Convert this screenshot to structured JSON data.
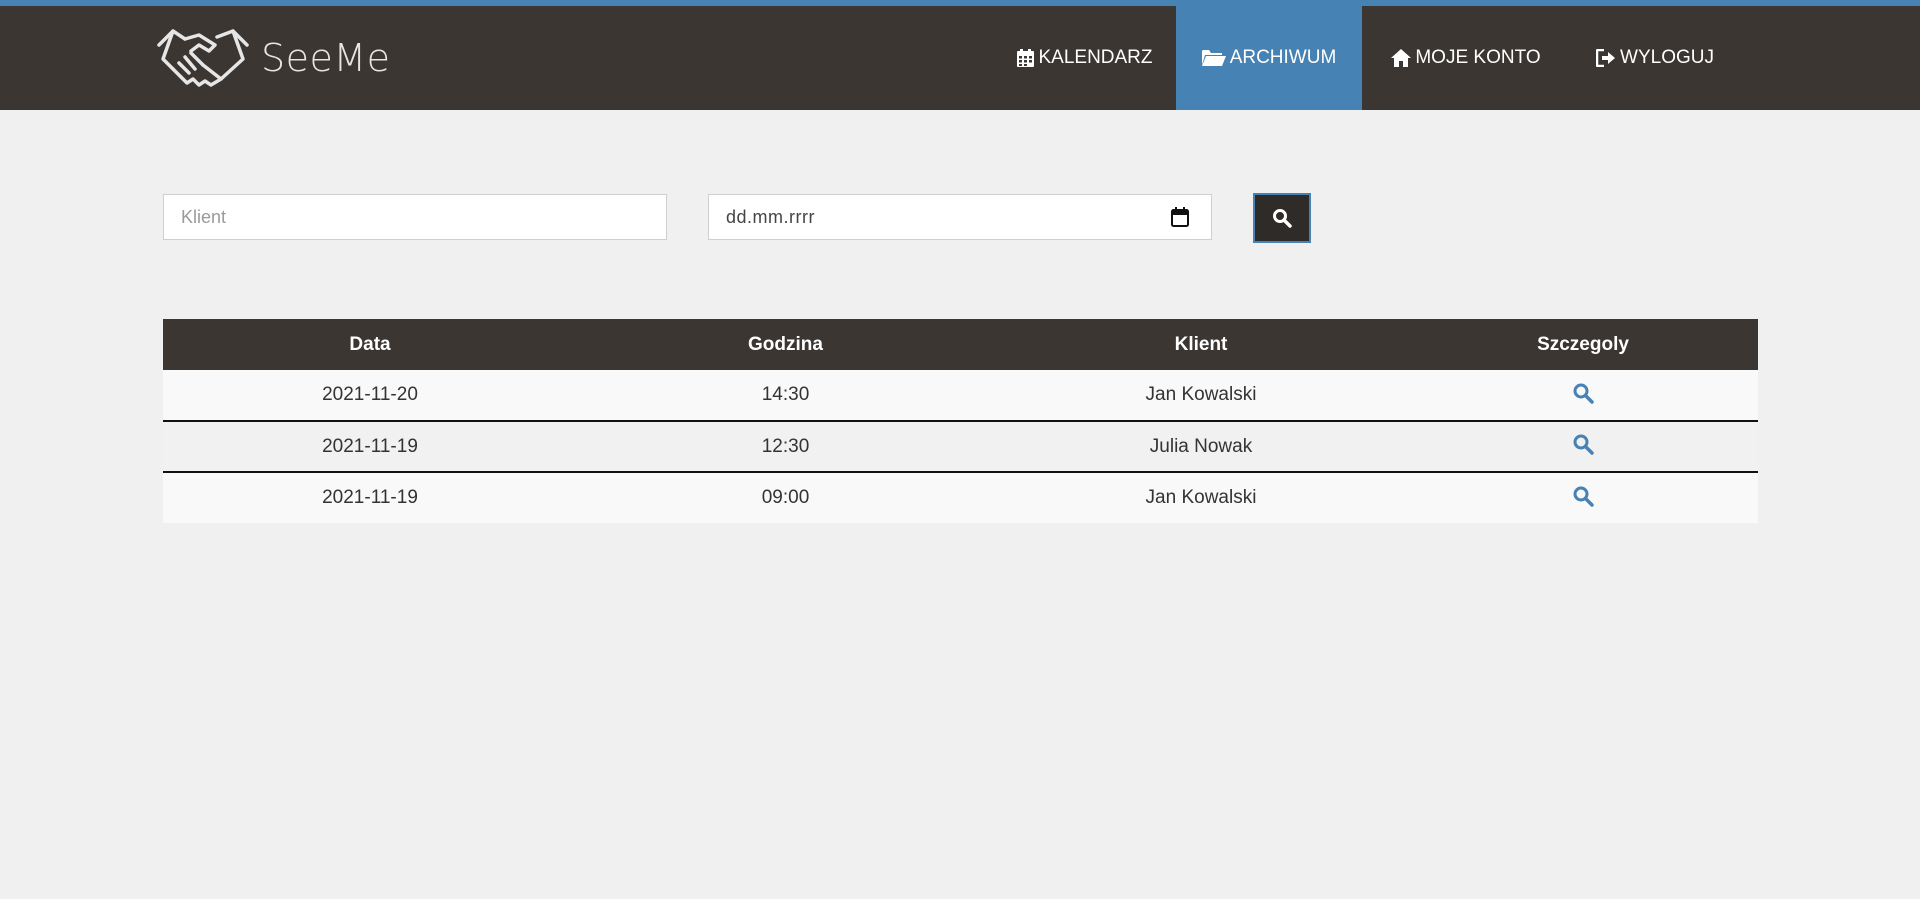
{
  "brand": {
    "name": "SeeMe",
    "logo_icon": "handshake-icon"
  },
  "nav": [
    {
      "label": "KALENDARZ",
      "icon": "calendar-icon",
      "active": false
    },
    {
      "label": "ARCHIWUM",
      "icon": "folder-open-icon",
      "active": true
    },
    {
      "label": "MOJE KONTO",
      "icon": "home-icon",
      "active": false
    },
    {
      "label": "WYLOGUJ",
      "icon": "logout-icon",
      "active": false
    }
  ],
  "filters": {
    "client_placeholder": "Klient",
    "date_placeholder": "dd.mm.rrrr",
    "search_icon": "search-icon"
  },
  "table": {
    "headers": [
      "Data",
      "Godzina",
      "Klient",
      "Szczegoly"
    ],
    "rows": [
      {
        "date": "2021-11-20",
        "time": "14:30",
        "client": "Jan Kowalski",
        "details_icon": "search-icon"
      },
      {
        "date": "2021-11-19",
        "time": "12:30",
        "client": "Julia Nowak",
        "details_icon": "search-icon"
      },
      {
        "date": "2021-11-19",
        "time": "09:00",
        "client": "Jan Kowalski",
        "details_icon": "search-icon"
      }
    ]
  },
  "colors": {
    "accent": "#4682b4",
    "navbar": "#3b3632",
    "background": "#f0f0f0"
  }
}
